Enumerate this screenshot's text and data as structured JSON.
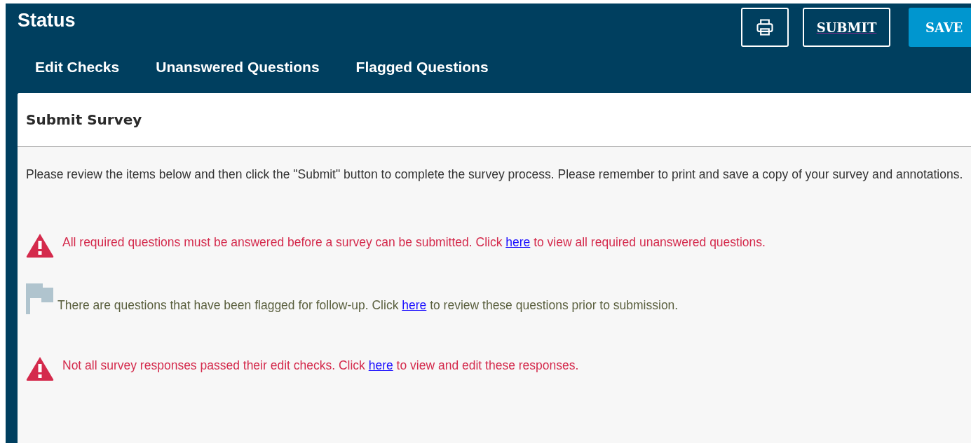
{
  "header": {
    "title": "Status",
    "tabs": [
      {
        "label": "Edit Checks"
      },
      {
        "label": "Unanswered Questions"
      },
      {
        "label": "Flagged Questions"
      }
    ],
    "buttons": [
      {
        "kind": "print"
      },
      {
        "kind": "outline",
        "label": "SUBMIT"
      },
      {
        "kind": "primary",
        "label": "SAVE"
      }
    ]
  },
  "card": {
    "title": "Submit Survey",
    "intro": "Please review the items below and then click the \"Submit\" button to complete the survey process. Please remember to print and save a copy of your survey and annotations.",
    "messages": [
      {
        "kind": "error",
        "before": "All required questions must be answered before a survey can be submitted. Click ",
        "link": "here",
        "after": " to view all required unanswered questions."
      },
      {
        "kind": "flag",
        "before": "There are questions that have been flagged for follow-up. Click ",
        "link": "here",
        "after": " to review these questions prior to submission."
      },
      {
        "kind": "error",
        "before": "Not all survey responses passed their edit checks. Click ",
        "link": "here",
        "after": " to view and edit these responses."
      }
    ]
  }
}
